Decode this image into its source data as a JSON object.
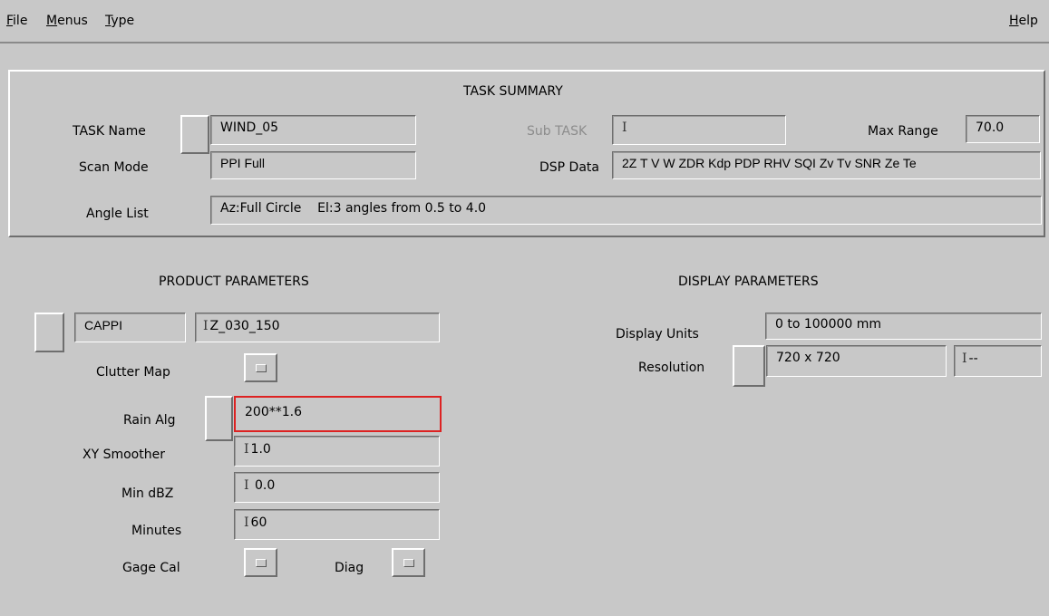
{
  "menubar": {
    "file": {
      "key": "F",
      "rest": "ile"
    },
    "menus": {
      "key": "M",
      "rest": "enus"
    },
    "type": {
      "key": "T",
      "rest": "ype"
    },
    "help": {
      "key": "H",
      "rest": "elp"
    }
  },
  "task_summary": {
    "title": "TASK SUMMARY",
    "task_name_label": "TASK Name",
    "task_name_value": "WIND_05",
    "sub_task_label": "Sub TASK",
    "sub_task_value": "",
    "max_range_label": "Max Range",
    "max_range_value": "70.0",
    "scan_mode_label": "Scan Mode",
    "scan_mode_value": "PPI Full",
    "dsp_data_label": "DSP Data",
    "dsp_data_value": "2Z T V W ZDR Kdp PDP RHV SQI Zv Tv SNR Ze Te",
    "angle_list_label": "Angle List",
    "angle_list_value": "Az:Full Circle    El:3 angles from 0.5 to 4.0"
  },
  "product": {
    "title": "PRODUCT PARAMETERS",
    "type_value": "CAPPI",
    "name_value": "Z_030_150",
    "clutter_map_label": "Clutter Map",
    "rain_alg_label": "Rain Alg",
    "rain_alg_value": "200**1.6",
    "xy_smoother_label": "XY Smoother",
    "xy_smoother_value": "1.0",
    "min_dbz_label": "Min dBZ",
    "min_dbz_value": " 0.0",
    "minutes_label": "Minutes",
    "minutes_value": "60",
    "gage_cal_label": "Gage Cal",
    "diag_label": "Diag"
  },
  "display": {
    "title": "DISPLAY PARAMETERS",
    "units_label": "Display Units",
    "units_value": "0 to 100000 mm",
    "resolution_label": "Resolution",
    "resolution_value": "720 x 720",
    "resolution_extra": "--"
  }
}
